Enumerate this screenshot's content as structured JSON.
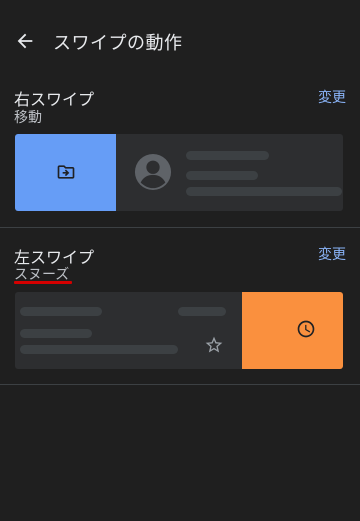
{
  "header": {
    "title": "スワイプの動作",
    "back_icon": "arrow-back-icon"
  },
  "right_swipe": {
    "title": "右スワイプ",
    "action": "移動",
    "change_label": "変更",
    "action_icon": "move-to-folder-icon",
    "accent": "#669df6"
  },
  "left_swipe": {
    "title": "左スワイプ",
    "action": "スヌーズ",
    "change_label": "変更",
    "action_icon": "clock-icon",
    "accent": "#fa903e"
  },
  "colors": {
    "background": "#1f1f1f",
    "card": "#2d2e30",
    "link": "#8ab4f8",
    "annotation": "#d50000"
  }
}
